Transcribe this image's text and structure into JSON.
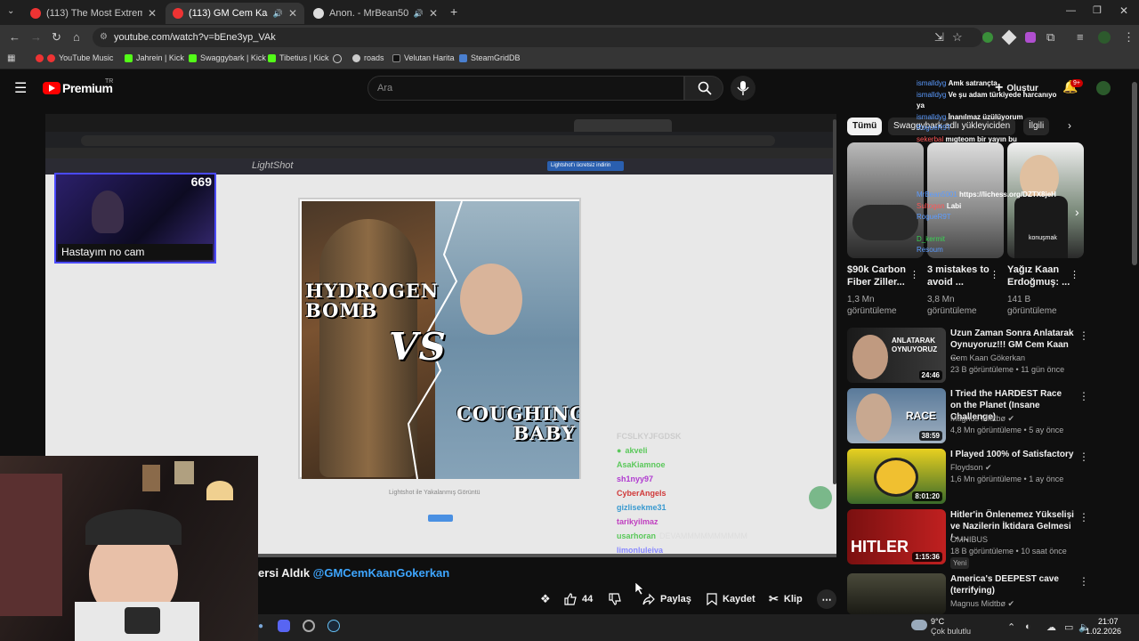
{
  "tabs": [
    {
      "title": "(113) The Most Extreme Flying",
      "active": false
    },
    {
      "title": "(113) GM Cem Kaan Gökerk",
      "active": true
    },
    {
      "title": "Anon. - MrBean5001 (1210",
      "active": false
    }
  ],
  "address": {
    "url": "youtube.com/watch?v=bEne3yp_VAk"
  },
  "bookmarks": [
    "YouTube Music",
    "Jahrein | Kick",
    "Swaggybark | Kick",
    "Tibetius | Kick",
    "roads",
    "Velutan Harita",
    "SteamGridDB"
  ],
  "yt_header": {
    "logo": "Premium",
    "logo_badge": "TR",
    "search_placeholder": "Ara",
    "create_label": "Oluştur",
    "notif_count": "9+"
  },
  "video": {
    "meme_top": "HYDROGEN\nBOMB",
    "meme_vs": "VS",
    "meme_bottom": "COUGHING\nBABY",
    "webcam_count": "669",
    "webcam_caption": "Hastayım no cam",
    "lightshot_caption": "Lightshot ile Yakalanmış Görüntü",
    "lightshot_brand": "LightShot",
    "lightshot_download": "Lightshot'ı ücretsiz indirin",
    "overlay_chat": [
      {
        "user": "FCSLKYJFGDSK",
        "msg": ""
      },
      {
        "user": "akveli",
        "msg": ""
      },
      {
        "user": "AsaKiamnoe",
        "msg": ""
      },
      {
        "user": "sh1nyy97",
        "msg": ""
      },
      {
        "user": "CyberAngels",
        "msg": ""
      },
      {
        "user": "gizlisekme31",
        "msg": ""
      },
      {
        "user": "tarikyilmaz",
        "msg": ""
      },
      {
        "user": "usarhoran",
        "msg": "DEVAMMMMMMMMMM"
      },
      {
        "user": "limonluleiva",
        "msg": ""
      }
    ]
  },
  "below_video": {
    "title_fragment": "ersi Aldık",
    "mention": "@GMCemKaanGokerkan",
    "like_count": "44",
    "share_label": "Paylaş",
    "save_label": "Kaydet",
    "clip_label": "Klip"
  },
  "sidebar": {
    "chips": [
      "Tümü",
      "Swaggybark adlı yükleyiciden",
      "İlgili"
    ],
    "shorts": [
      {
        "title": "$90k Carbon Fiber Ziller...",
        "views": "1,3 Mn görüntüleme"
      },
      {
        "title": "3 mistakes to avoid ...",
        "views": "3,8 Mn görüntüleme"
      },
      {
        "title": "Yağız Kaan Erdoğmuş: ...",
        "views": "141 B görüntüleme"
      }
    ],
    "short_overlay_text": "konuşmak",
    "videos": [
      {
        "title": "Uzun Zaman Sonra Anlatarak Oynuyoruz!!! GM Cem Kaan ...",
        "channel": "Cem Kaan Gökerkan",
        "meta": "23 B görüntüleme • 11 gün önce",
        "duration": "24:46",
        "thumb_text": "ANLATARAK OYNUYORUZ",
        "badge": ""
      },
      {
        "title": "I Tried the HARDEST Race on the Planet (Insane Challenge)",
        "channel": "Magnus Midtbø",
        "meta": "4,8 Mn görüntüleme • 5 ay önce",
        "duration": "38:59",
        "thumb_text": "RACE",
        "badge": ""
      },
      {
        "title": "I Played 100% of Satisfactory",
        "channel": "Floydson",
        "meta": "1,6 Mn görüntüleme • 1 ay önce",
        "duration": "8:01:20",
        "thumb_text": "",
        "badge": ""
      },
      {
        "title": "Hitler'in Önlenemez Yükselişi ve Nazilerin İktidara Gelmesi / - ...",
        "channel": "OMNIBUS",
        "meta": "18 B görüntüleme • 10 saat önce",
        "duration": "1:15:36",
        "thumb_text": "HITLER",
        "badge": "Yeni"
      },
      {
        "title": "America's DEEPEST cave (terrifying)",
        "channel": "Magnus Midtbø",
        "meta": "",
        "duration": "",
        "thumb_text": "",
        "badge": ""
      }
    ]
  },
  "yt_chat_overlay": [
    {
      "user": "ismalldyg",
      "msg": "Amk satrançta",
      "color": "u"
    },
    {
      "user": "ismalldyg",
      "msg": "Ve şu adam türkiyede harcanıyo ya",
      "color": "u"
    },
    {
      "user": "ismalldyg",
      "msg": "İnanılmaz üzülüyorum",
      "color": "u"
    },
    {
      "user": "RogueR9T",
      "msg": "",
      "color": "u"
    },
    {
      "user": "sekerbal",
      "msg": "mıgteom bir yayın bu",
      "color": "r"
    },
    {
      "user": "MrBean5001",
      "msg": "https://lichess.org/DZTX8jeH",
      "color": "u"
    },
    {
      "user": "Sultogan",
      "msg": "Labi",
      "color": "r"
    },
    {
      "user": "RogueR9T",
      "msg": "",
      "color": "u"
    },
    {
      "user": "D_kermit",
      "msg": "",
      "color": "g"
    },
    {
      "user": "Resoum",
      "msg": "",
      "color": "u"
    }
  ],
  "taskbar": {
    "weather_temp": "9°C",
    "weather_desc": "Çok bulutlu",
    "time": "21:07",
    "date": "1.02.2026"
  }
}
